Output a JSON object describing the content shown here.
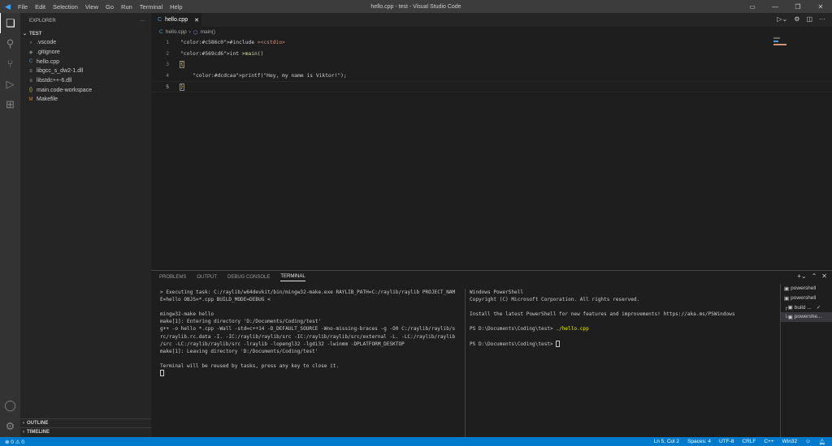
{
  "window": {
    "title": "hello.cpp - test - Visual Studio Code"
  },
  "menu": [
    "File",
    "Edit",
    "Selection",
    "View",
    "Go",
    "Run",
    "Terminal",
    "Help"
  ],
  "sidebar": {
    "title": "EXPLORER",
    "folder": "TEST",
    "files": [
      {
        "name": ".vscode",
        "icon": "chevron-right",
        "color": "#ccc"
      },
      {
        "name": ".gitignore",
        "icon": "diamond",
        "color": "#6d8086"
      },
      {
        "name": "hello.cpp",
        "icon": "C",
        "color": "#519aba"
      },
      {
        "name": "libgcc_s_dw2-1.dll",
        "icon": "≡",
        "color": "#aaa"
      },
      {
        "name": "libstdc++-6.dll",
        "icon": "≡",
        "color": "#aaa"
      },
      {
        "name": "main.code-workspace",
        "icon": "{}",
        "color": "#cbcb41"
      },
      {
        "name": "Makefile",
        "icon": "M",
        "color": "#e37933"
      }
    ],
    "outline": "OUTLINE",
    "timeline": "TIMELINE"
  },
  "editor": {
    "tab": "hello.cpp",
    "breadcrumb": [
      "hello.cpp",
      "main()"
    ],
    "lines": [
      {
        "n": "1",
        "text": "#include <cstdio>"
      },
      {
        "n": "2",
        "text": "int main()"
      },
      {
        "n": "3",
        "text": "{"
      },
      {
        "n": "4",
        "text": "    printf(\"Hey, my name is Viktor!\");"
      },
      {
        "n": "5",
        "text": "}"
      }
    ]
  },
  "panel": {
    "tabs": [
      "PROBLEMS",
      "OUTPUT",
      "DEBUG CONSOLE",
      "TERMINAL"
    ],
    "term1": "> Executing task: C:/raylib/w64devkit/bin/mingw32-make.exe RAYLIB_PATH=C:/raylib/raylib PROJECT_NAM\nE=hello OBJS=*.cpp BUILD_MODE=DEBUG <\n\nmingw32-make hello\nmake[1]: Entering directory 'D:/Documents/Coding/test'\ng++ -o hello *.cpp -Wall -std=c++14 -D_DEFAULT_SOURCE -Wno-missing-braces -g -O0 C:/raylib/raylib/s\nrc/raylib.rc.data -I. -IC:/raylib/raylib/src -IC:/raylib/raylib/src/external -L. -LC:/raylib/raylib\n/src -LC:/raylib/raylib/src -lraylib -lopengl32 -lgdi32 -lwinmm -DPLATFORM_DESKTOP\nmake[1]: Leaving directory 'D:/Documents/Coding/test'\n\nTerminal will be reused by tasks, press any key to close it.",
    "term2": "Windows PowerShell\nCopyright (C) Microsoft Corporation. All rights reserved.\n\nInstall the latest PowerShell for new features and improvements! https://aka.ms/PSWindows\n\nPS D:\\Documents\\Coding\\test> ",
    "term2_cmd": "./hello.cpp",
    "term2_prompt": "\n\nPS D:\\Documents\\Coding\\test> ",
    "terminals": [
      "powershell",
      "powershell",
      "build ...",
      "powershe..."
    ]
  },
  "status": {
    "errors": "0",
    "warnings": "0",
    "items": [
      "Ln 5, Col 2",
      "Spaces: 4",
      "UTF-8",
      "CRLF",
      "C++",
      "Win32"
    ]
  }
}
